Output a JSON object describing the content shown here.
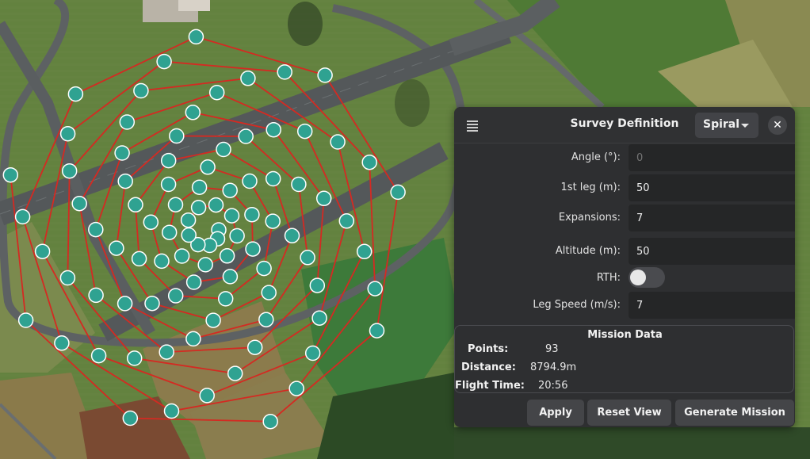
{
  "panel": {
    "title": "Survey Definition",
    "pattern": "Spiral",
    "close": "✕"
  },
  "fields": [
    {
      "label": "Angle (°):",
      "value": "",
      "placeholder": "0"
    },
    {
      "label": "1st leg (m):",
      "value": "50"
    },
    {
      "label": "Expansions:",
      "value": "7"
    },
    {
      "label": "Altitude (m):",
      "value": "50"
    },
    {
      "label": "RTH:",
      "toggle_on": false
    },
    {
      "label": "Leg Speed (m/s):",
      "value": "7"
    }
  ],
  "mission": {
    "title": "Mission Data",
    "points_label": "Points:",
    "points": "93",
    "distance_label": "Distance:",
    "distance": "8794.9m",
    "flight_time_label": "Flight Time:",
    "flight_time": "20:56"
  },
  "buttons": {
    "apply": "Apply",
    "reset_view": "Reset View",
    "generate": "Generate Mission"
  },
  "colors": {
    "path": "#d42a22",
    "waypoint_fill": "#2fa291",
    "waypoint_stroke": "#ffffff",
    "panel_bg": "#2e2f31"
  },
  "icons": [
    "menu-icon",
    "chevron-down-icon",
    "close-icon"
  ]
}
